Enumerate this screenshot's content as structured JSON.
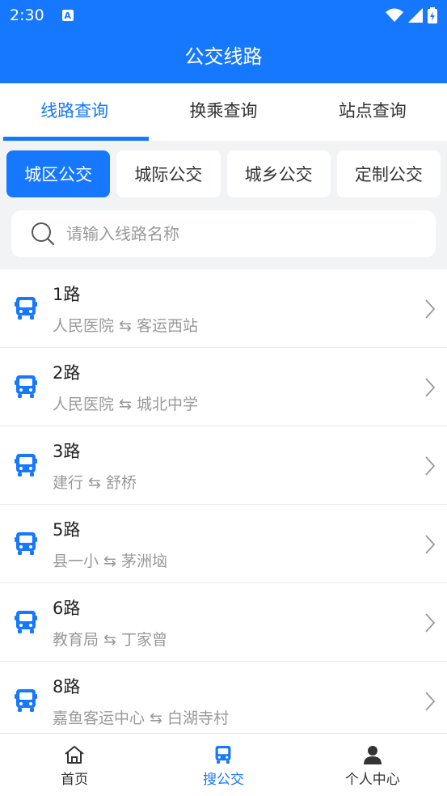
{
  "status_bar": {
    "time": "2:30",
    "notification": "A"
  },
  "header": {
    "title": "公交线路"
  },
  "tabs": [
    {
      "label": "线路查询",
      "active": true
    },
    {
      "label": "换乘查询",
      "active": false
    },
    {
      "label": "站点查询",
      "active": false
    }
  ],
  "categories": [
    {
      "label": "城区公交",
      "active": true
    },
    {
      "label": "城际公交",
      "active": false
    },
    {
      "label": "城乡公交",
      "active": false
    },
    {
      "label": "定制公交",
      "active": false
    }
  ],
  "search": {
    "placeholder": "请输入线路名称",
    "value": ""
  },
  "routes": [
    {
      "name": "1路",
      "path": "人民医院 ⇆ 客运西站"
    },
    {
      "name": "2路",
      "path": "人民医院 ⇆ 城北中学"
    },
    {
      "name": "3路",
      "path": "建行 ⇆ 舒桥"
    },
    {
      "name": "5路",
      "path": "县一小 ⇆ 茅洲垴"
    },
    {
      "name": "6路",
      "path": "教育局 ⇆ 丁家曾"
    },
    {
      "name": "8路",
      "path": "嘉鱼客运中心 ⇆ 白湖寺村"
    }
  ],
  "bottom_nav": [
    {
      "label": "首页",
      "icon": "home-icon",
      "active": false
    },
    {
      "label": "搜公交",
      "icon": "bus-icon",
      "active": true
    },
    {
      "label": "个人中心",
      "icon": "person-icon",
      "active": false
    }
  ],
  "colors": {
    "primary": "#1677ff",
    "background": "#f2f3f5"
  }
}
